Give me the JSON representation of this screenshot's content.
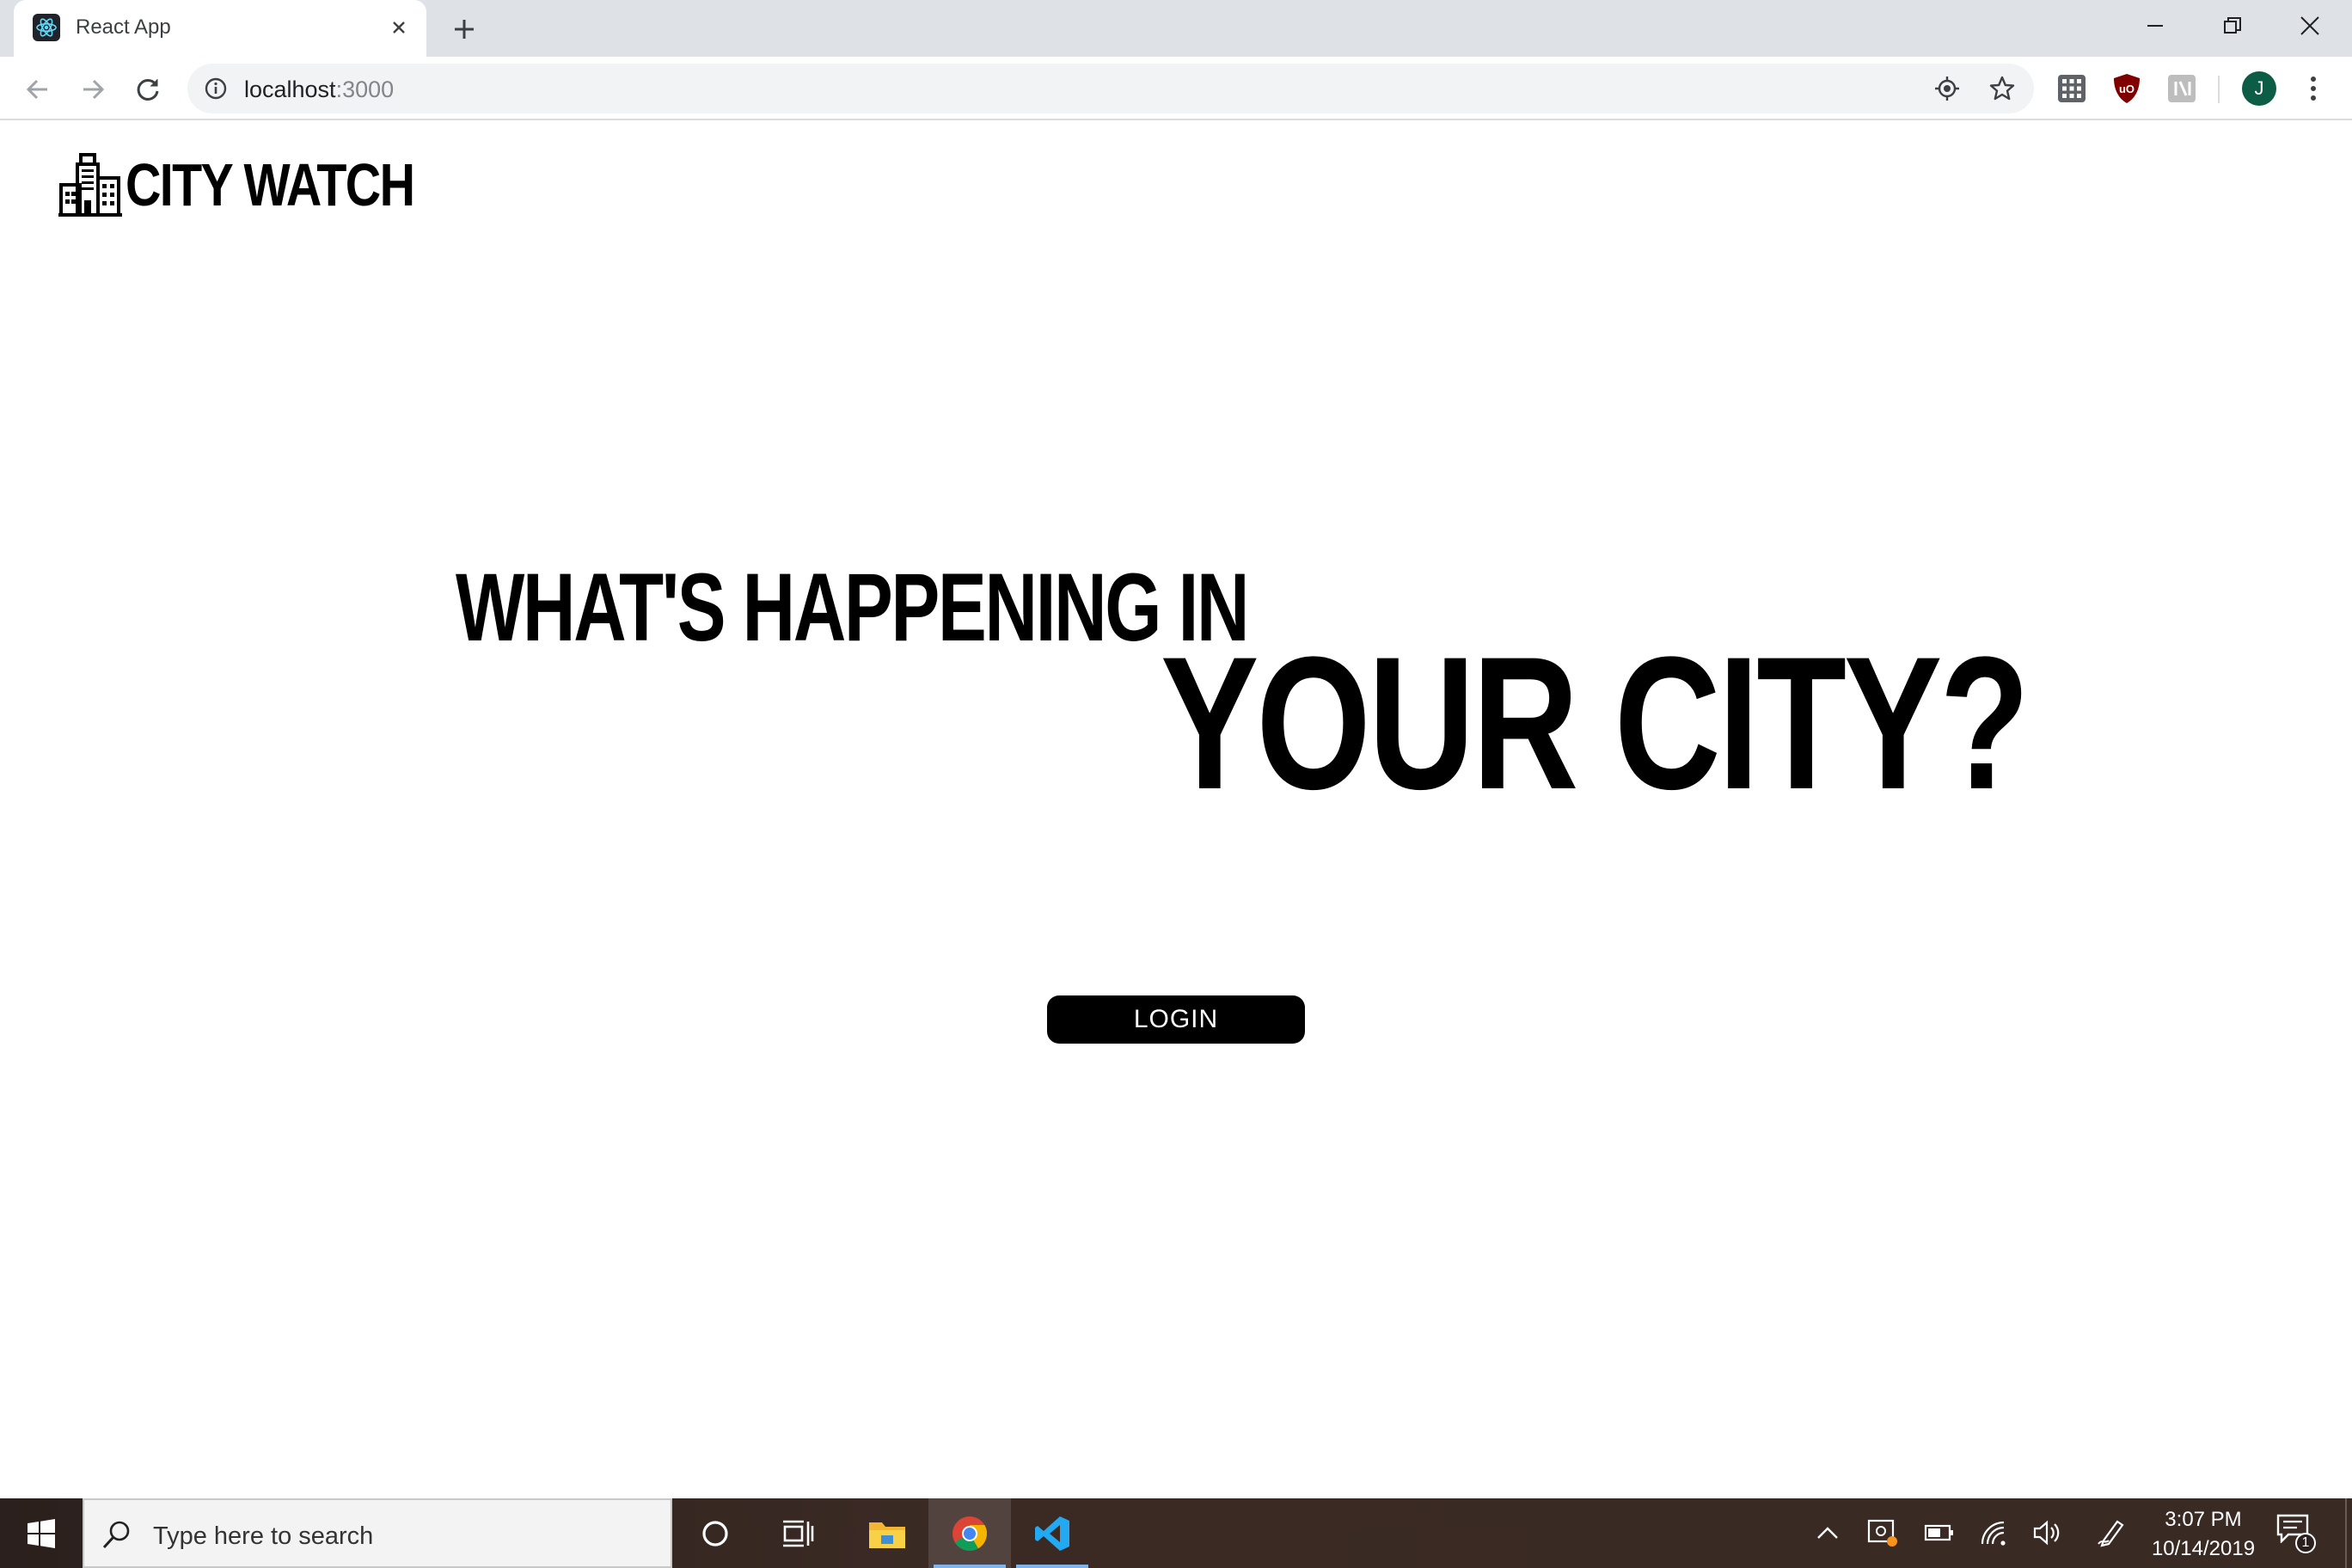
{
  "browser": {
    "tab_title": "React App",
    "url_host": "localhost",
    "url_port": ":3000",
    "profile_initial": "J"
  },
  "page": {
    "brand_name": "CITY WATCH",
    "hero_line1": "WHAT'S HAPPENING IN",
    "hero_line2": "YOUR CITY?",
    "login_label": "LOGIN"
  },
  "taskbar": {
    "search_placeholder": "Type here to search",
    "time": "3:07 PM",
    "date": "10/14/2019",
    "notification_count": "1"
  },
  "icons": {
    "tab_favicon": "react-logo-icon",
    "tab_close": "close-icon",
    "new_tab": "plus-icon",
    "minimize": "minimize-icon",
    "restore": "restore-icon",
    "close_window": "close-icon",
    "back": "arrow-left-icon",
    "forward": "arrow-right-icon",
    "reload": "reload-icon",
    "site_info": "info-icon",
    "location": "location-target-icon",
    "bookmark": "star-icon",
    "ext_apps": "grid-icon",
    "ext_ublock": "ublock-shield-icon",
    "ext_translate": "translate-icon",
    "menu": "kebab-menu-icon",
    "start": "windows-logo-icon",
    "cortana": "circle-icon",
    "task_view": "task-view-icon",
    "file_explorer": "folder-icon",
    "chrome": "chrome-icon",
    "vscode": "vscode-icon"
  },
  "colors": {
    "tabstrip_bg": "#dee1e6",
    "omnibox_bg": "#f1f3f4",
    "login_bg": "#000000",
    "taskbar_bg": "#2b201d",
    "profile_bg": "#0d5c45"
  }
}
